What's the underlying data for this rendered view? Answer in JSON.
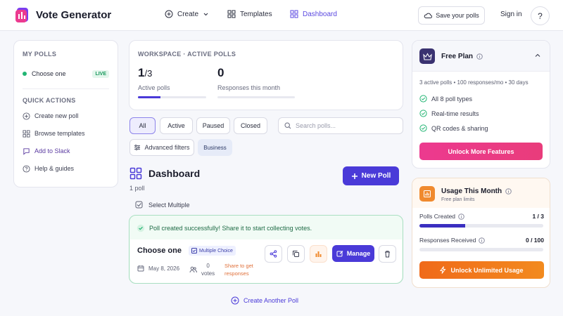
{
  "header": {
    "brand": "Vote Generator",
    "nav": {
      "create": "Create",
      "templates": "Templates",
      "dashboard": "Dashboard"
    },
    "save_polls": "Save your polls",
    "sign_in": "Sign in",
    "help": "?"
  },
  "sidebar": {
    "my_polls_heading": "MY POLLS",
    "polls": [
      {
        "name": "Choose one",
        "status": "LIVE"
      }
    ],
    "quick_actions_heading": "QUICK ACTIONS",
    "actions": [
      {
        "label": "Create new poll",
        "icon": "plus-circle-icon"
      },
      {
        "label": "Browse templates",
        "icon": "grid-icon"
      },
      {
        "label": "Add to Slack",
        "icon": "chat-icon"
      },
      {
        "label": "Help & guides",
        "icon": "question-icon"
      }
    ]
  },
  "stats": {
    "heading": "WORKSPACE · ACTIVE POLLS",
    "active_value": "1",
    "active_total": "/3",
    "active_label": "Active polls",
    "active_progress": 0.33,
    "responses_value": "0",
    "responses_label": "Responses this month",
    "responses_progress": 0
  },
  "filters": {
    "tabs": [
      "All",
      "Active",
      "Paused",
      "Closed"
    ],
    "selected": "All",
    "search_placeholder": "Search polls...",
    "advanced": "Advanced filters",
    "business": "Business"
  },
  "dashboard": {
    "title": "Dashboard",
    "count": "1 poll",
    "new_poll": "New Poll",
    "select_multiple": "Select Multiple",
    "create_another": "Create Another Poll"
  },
  "poll_card": {
    "success_message": "Poll created successfully! Share it to start collecting votes.",
    "title": "Choose one",
    "type_badge": "Multiple Choice",
    "date": "May 8, 2026",
    "votes_count": "0",
    "votes_label": "votes",
    "share_hint": "Share to get responses",
    "manage": "Manage"
  },
  "plan": {
    "title": "Free Plan",
    "summary": "3 active polls • 100 responses/mo • 30 days",
    "features": [
      "All 8 poll types",
      "Real-time results",
      "QR codes & sharing"
    ],
    "unlock": "Unlock More Features"
  },
  "usage": {
    "title": "Usage This Month",
    "subtitle": "Free plan limits",
    "polls_label": "Polls Created",
    "polls_value": "1 / 3",
    "polls_progress": 0.37,
    "responses_label": "Responses Received",
    "responses_value": "0 / 100",
    "responses_progress": 0,
    "unlock": "Unlock Unlimited Usage"
  },
  "colors": {
    "primary": "#4a3ad8",
    "success": "#22b573",
    "pink": "#ec3a8f",
    "orange": "#f28a1e"
  }
}
